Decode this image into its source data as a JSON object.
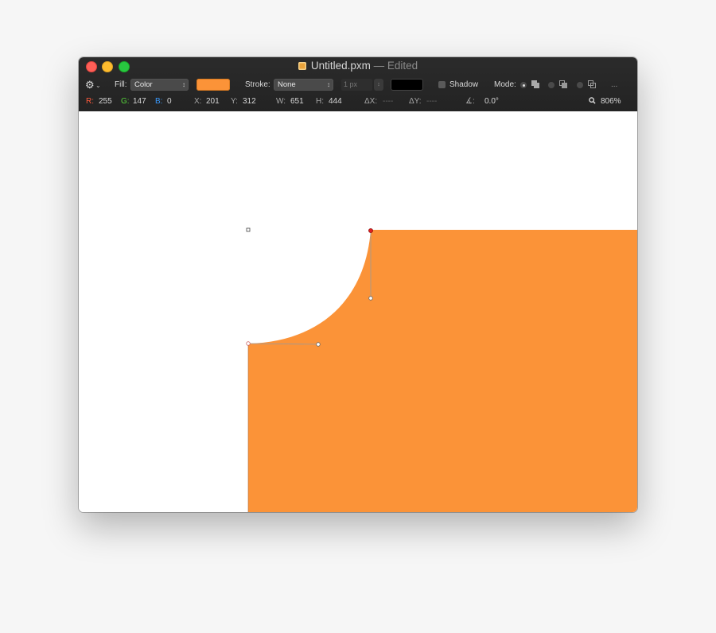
{
  "window": {
    "filename": "Untitled.pxm",
    "edited_suffix": "— Edited"
  },
  "toolbar": {
    "gear_icon": "gear-icon",
    "fill_label": "Fill:",
    "fill_type": "Color",
    "fill_color": "#fb9338",
    "stroke_label": "Stroke:",
    "stroke_type": "None",
    "stroke_width": "1 px",
    "stroke_color": "#000000",
    "shadow_label": "Shadow",
    "mode_label": "Mode:",
    "more_label": "..."
  },
  "status": {
    "r_label": "R:",
    "r_value": "255",
    "g_label": "G:",
    "g_value": "147",
    "b_label": "B:",
    "b_value": "0",
    "x_label": "X:",
    "x_value": "201",
    "y_label": "Y:",
    "y_value": "312",
    "w_label": "W:",
    "w_value": "651",
    "h_label": "H:",
    "h_value": "444",
    "dx_label": "ΔX:",
    "dx_value": "----",
    "dy_label": "ΔY:",
    "dy_value": "----",
    "angle_label": "∡:",
    "angle_value": "0.0°",
    "zoom_value": "806%"
  },
  "canvas": {
    "shape_color": "#fb9338",
    "anchor_selected_color": "#e02020"
  }
}
